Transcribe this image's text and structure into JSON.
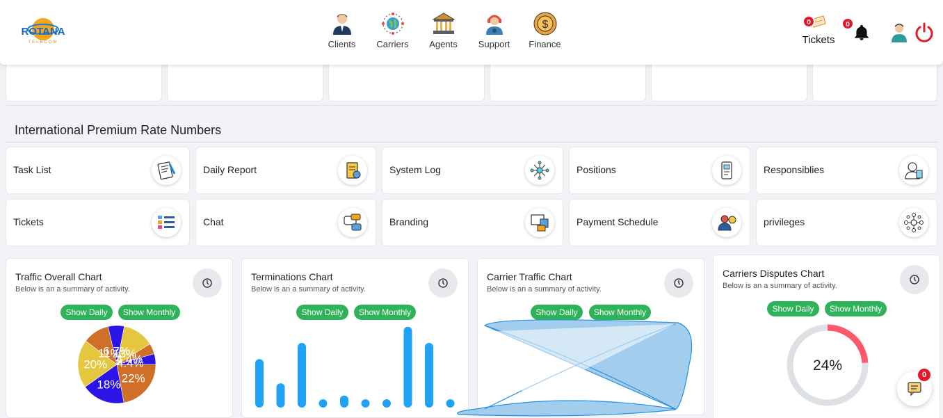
{
  "brand": {
    "name": "ROTANA",
    "sub": "TELECOM"
  },
  "nav": [
    {
      "label": "Clients",
      "icon": "clients-icon"
    },
    {
      "label": "Carriers",
      "icon": "carriers-globe-icon"
    },
    {
      "label": "Agents",
      "icon": "agents-bank-icon"
    },
    {
      "label": "Support",
      "icon": "support-headset-icon"
    },
    {
      "label": "Finance",
      "icon": "finance-dollar-icon"
    }
  ],
  "header": {
    "tickets_label": "Tickets",
    "tickets_count": "0",
    "notifications_count": "0"
  },
  "section_title": "International Premium Rate Numbers",
  "tiles": [
    {
      "label": "Task List",
      "icon": "task-list-icon"
    },
    {
      "label": "Daily Report",
      "icon": "daily-report-icon"
    },
    {
      "label": "System Log",
      "icon": "system-log-icon"
    },
    {
      "label": "Positions",
      "icon": "positions-icon"
    },
    {
      "label": "Responsiblies",
      "icon": "responsibilities-icon"
    },
    {
      "label": "Tickets",
      "icon": "tickets-icon"
    },
    {
      "label": "Chat",
      "icon": "chat-icon"
    },
    {
      "label": "Branding",
      "icon": "branding-icon"
    },
    {
      "label": "Payment Schedule",
      "icon": "payment-schedule-icon"
    },
    {
      "label": "privileges",
      "icon": "privileges-icon"
    }
  ],
  "buttons": {
    "daily": "Show Daily",
    "monthly": "Show Monthly"
  },
  "charts": [
    {
      "title": "Traffic Overall Chart",
      "subtitle": "Below is an a summary of activity."
    },
    {
      "title": "Terminations Chart",
      "subtitle": "Below is an a summary of activity."
    },
    {
      "title": "Carrier Traffic Chart",
      "subtitle": "Below is an a summary of activity."
    },
    {
      "title": "Carriers Disputes Chart",
      "subtitle": "Below is an a summary of activity."
    }
  ],
  "chat_count": "0",
  "colors": {
    "accent_green": "#2fb35a",
    "badge_red": "#e5182a",
    "bar_blue": "#21a3f5"
  },
  "chart_data": [
    {
      "type": "pie",
      "title": "Traffic Overall Chart",
      "slices": [
        {
          "label": "22%",
          "value": 22,
          "color": "#cf6f28"
        },
        {
          "label": "18%",
          "value": 18,
          "color": "#2a14e6"
        },
        {
          "label": "20%",
          "value": 20,
          "color": "#e5c73f"
        },
        {
          "label": "11%",
          "value": 11,
          "color": "#cf6f28"
        },
        {
          "label": "6.7%",
          "value": 6.7,
          "color": "#2a14e6"
        },
        {
          "label": "13%",
          "value": 13,
          "color": "#e5c73f"
        },
        {
          "label": "4.4%",
          "value": 4.4,
          "color": "#cf6f28"
        },
        {
          "label": "4.4%",
          "value": 4.4,
          "color": "#2a14e6"
        }
      ]
    },
    {
      "type": "bar",
      "title": "Terminations Chart",
      "values": [
        12,
        6,
        16,
        1,
        3,
        1,
        1,
        20,
        16,
        1
      ],
      "ylim": [
        0,
        21
      ]
    },
    {
      "type": "area",
      "title": "Carrier Traffic Chart",
      "values": [],
      "note": "area polygon only, no labels"
    },
    {
      "type": "pie",
      "title": "Carriers Disputes Chart",
      "value": 24,
      "label": "24%"
    }
  ]
}
